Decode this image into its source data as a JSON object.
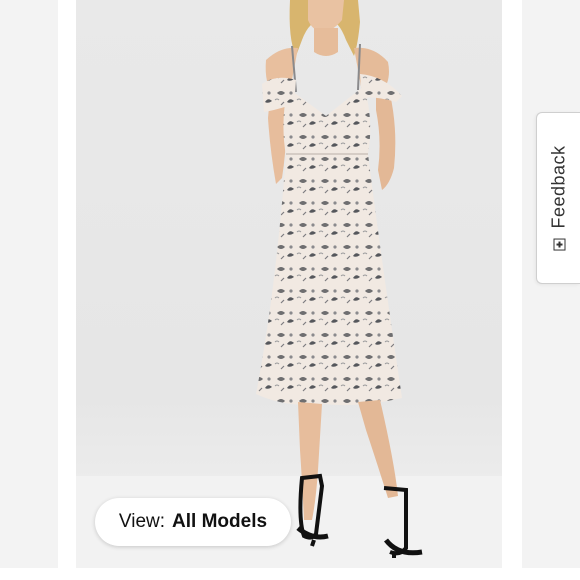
{
  "product_image": {
    "alt_icon": "model-dress-photo"
  },
  "view_selector": {
    "label": "View:",
    "value": "All Models"
  },
  "feedback": {
    "label": "Feedback",
    "icon": "plus-box-icon"
  },
  "colors": {
    "background": "#ffffff",
    "photo_backdrop": "#e8e8e8",
    "pill_bg": "#ffffff",
    "text": "#111111"
  }
}
